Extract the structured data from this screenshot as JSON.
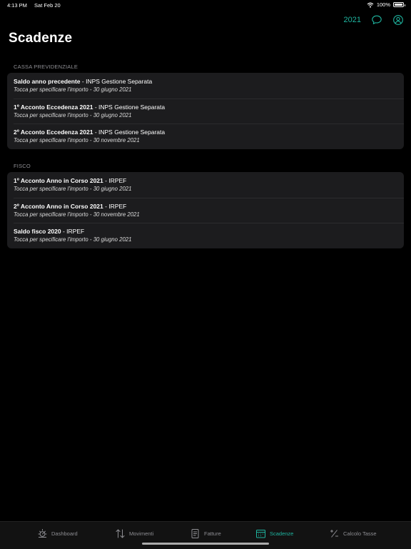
{
  "status_bar": {
    "time": "4:13 PM",
    "date": "Sat Feb 20",
    "battery": "100%"
  },
  "nav": {
    "year": "2021",
    "icons": {
      "chat": "chat-bubble-icon",
      "profile": "person-circle-icon"
    }
  },
  "page": {
    "title": "Scadenze"
  },
  "sections": [
    {
      "header": "CASSA PREVIDENZIALE",
      "items": [
        {
          "title": "Saldo anno precedente",
          "subtitle": " - INPS Gestione Separata",
          "detail": "Tocca per specificare l'importo - 30 giugno 2021"
        },
        {
          "title": "1º Acconto Eccedenza 2021",
          "subtitle": " - INPS Gestione Separata",
          "detail": "Tocca per specificare l'importo - 30 giugno 2021"
        },
        {
          "title": "2º Acconto Eccedenza 2021",
          "subtitle": " - INPS Gestione Separata",
          "detail": "Tocca per specificare l'importo - 30 novembre 2021"
        }
      ]
    },
    {
      "header": "FISCO",
      "items": [
        {
          "title": "1º Acconto Anno in Corso 2021",
          "subtitle": " - IRPEF",
          "detail": "Tocca per specificare l'importo - 30 giugno 2021"
        },
        {
          "title": "2º Acconto Anno in Corso 2021",
          "subtitle": " - IRPEF",
          "detail": "Tocca per specificare l'importo - 30 novembre 2021"
        },
        {
          "title": "Saldo fisco 2020",
          "subtitle": " - IRPEF",
          "detail": "Tocca per specificare l'importo - 30 giugno 2021"
        }
      ]
    }
  ],
  "tab_bar": {
    "tabs": [
      {
        "label": "Dashboard",
        "icon": "sun-gauge-icon"
      },
      {
        "label": "Movimenti",
        "icon": "arrows-up-down-icon"
      },
      {
        "label": "Fatture",
        "icon": "document-icon"
      },
      {
        "label": "Scadenze",
        "icon": "calendar-icon",
        "active": true
      },
      {
        "label": "Calcolo Tasse",
        "icon": "plus-minus-icon"
      }
    ]
  },
  "colors": {
    "accent": "#1fb5a0",
    "background": "#000000",
    "card": "#1c1c1e",
    "secondary_text": "#8e8e93"
  }
}
